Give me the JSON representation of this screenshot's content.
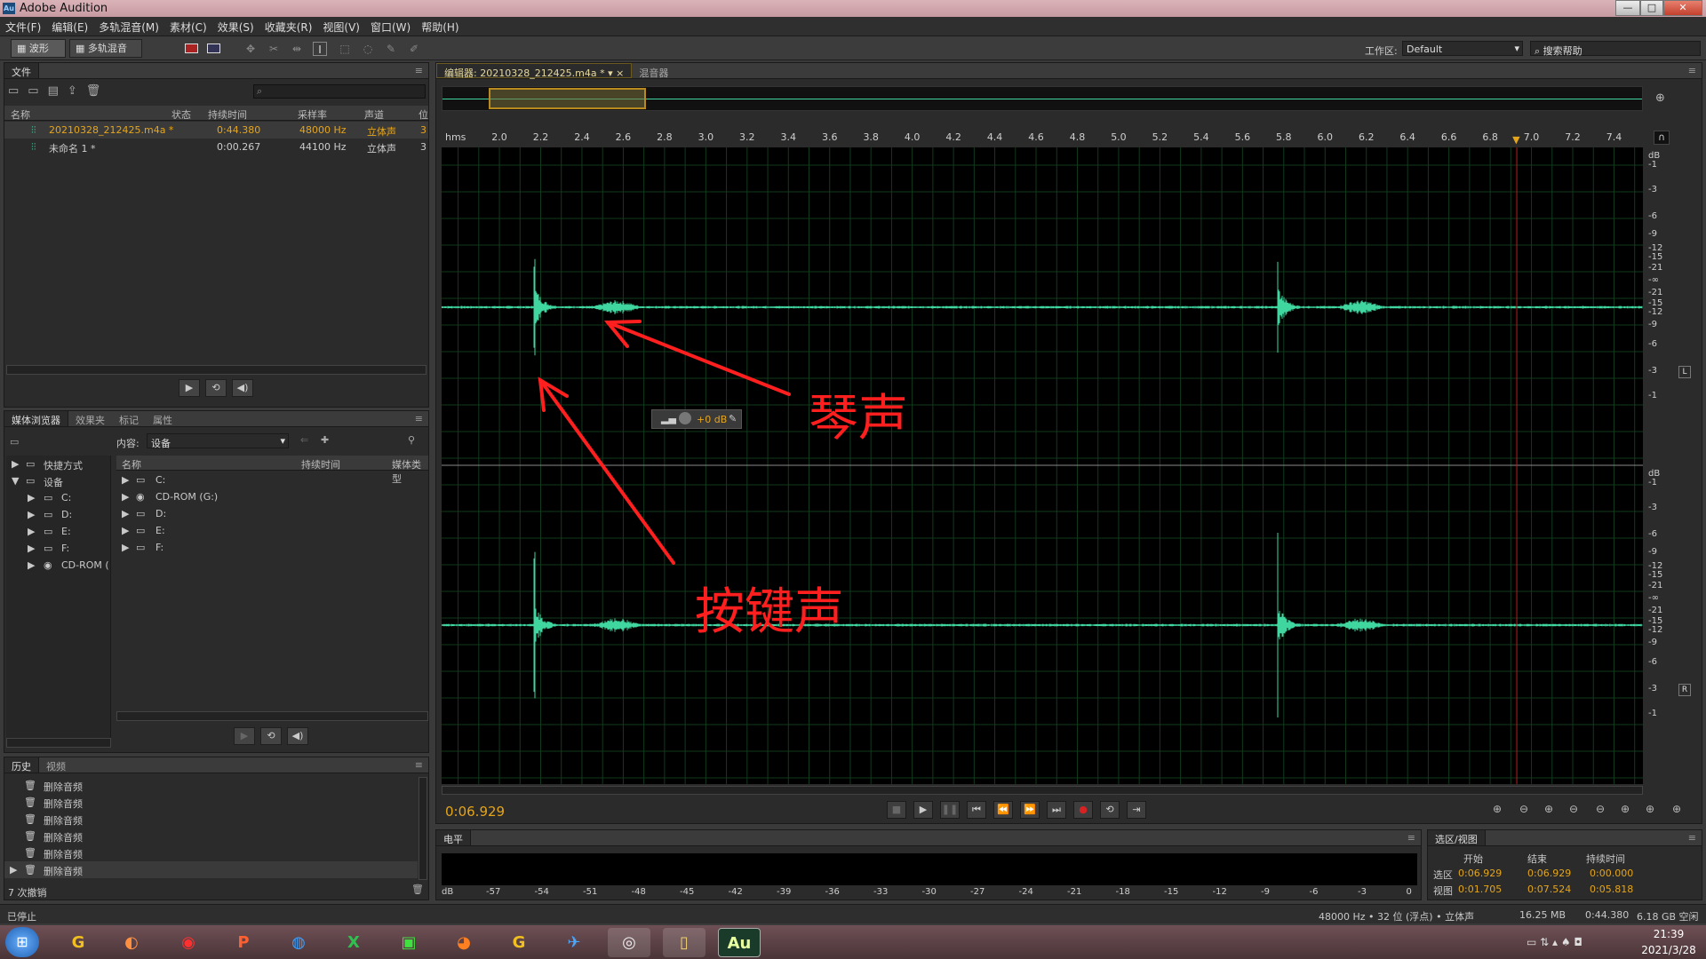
{
  "app": {
    "title": "Adobe Audition",
    "logo": "Au"
  },
  "window_buttons": [
    "—",
    "□",
    "✕"
  ],
  "menu": [
    "文件(F)",
    "编辑(E)",
    "多轨混音(M)",
    "素材(C)",
    "效果(S)",
    "收藏夹(R)",
    "视图(V)",
    "窗口(W)",
    "帮助(H)"
  ],
  "toolbar": {
    "waveform": "波形",
    "multitrack": "多轨混音",
    "workspace_label": "工作区:",
    "workspace_value": "Default",
    "search_placeholder": "搜索帮助"
  },
  "files_panel": {
    "tab": "文件",
    "columns": [
      "名称",
      "状态",
      "持续时间",
      "采样率",
      "声道",
      "位"
    ],
    "rows": [
      {
        "name": "20210328_212425.m4a *",
        "duration": "0:44.380",
        "rate": "48000 Hz",
        "channels": "立体声",
        "bits": "3"
      },
      {
        "name": "未命名 1 *",
        "duration": "0:00.267",
        "rate": "44100 Hz",
        "channels": "立体声",
        "bits": "3"
      }
    ]
  },
  "media_panel": {
    "tabs": [
      "媒体浏览器",
      "效果夹",
      "标记",
      "属性"
    ],
    "content_label": "内容:",
    "content_value": "设备",
    "tree": [
      {
        "label": "快捷方式"
      },
      {
        "label": "设备"
      },
      {
        "label": "C:"
      },
      {
        "label": "D:"
      },
      {
        "label": "E:"
      },
      {
        "label": "F:"
      },
      {
        "label": "CD-ROM ("
      }
    ],
    "columns": [
      "名称",
      "持续时间",
      "媒体类型"
    ],
    "items": [
      "C:",
      "CD-ROM (G:)",
      "D:",
      "E:",
      "F:"
    ]
  },
  "history_panel": {
    "tabs": [
      "历史",
      "视频"
    ],
    "items": [
      "删除音频",
      "删除音频",
      "删除音频",
      "删除音频",
      "删除音频",
      "删除音频"
    ],
    "undo_count": "7 次撤销"
  },
  "editor": {
    "tabs": [
      "编辑器: 20210328_212425.m4a *",
      "混音器"
    ],
    "ruler_unit": "hms",
    "ticks": [
      "2.0",
      "2.2",
      "2.4",
      "2.6",
      "2.8",
      "3.0",
      "3.2",
      "3.4",
      "3.6",
      "3.8",
      "4.0",
      "4.2",
      "4.4",
      "4.6",
      "4.8",
      "5.0",
      "5.2",
      "5.4",
      "5.6",
      "5.8",
      "6.0",
      "6.2",
      "6.4",
      "6.6",
      "6.8",
      "7.0",
      "7.2",
      "7.4"
    ],
    "db_labels_top": [
      "dB",
      "-1",
      "-3",
      "-6",
      "-9",
      "-12",
      "-15",
      "-21",
      "-∞",
      "-21",
      "-15",
      "-12",
      "-9",
      "-6",
      "-3",
      "-1"
    ],
    "db_labels_bottom": [
      "dB",
      "-1",
      "-3",
      "-6",
      "-9",
      "-12",
      "-15",
      "-21",
      "-∞",
      "-21",
      "-15",
      "-12",
      "-9",
      "-6",
      "-3",
      "-1"
    ],
    "channel_left": "L",
    "channel_right": "R",
    "hud": "+0 dB",
    "current_time": "0:06.929",
    "playhead_seconds": 6.929,
    "view_start": 1.705,
    "view_end": 7.524,
    "transient_times": [
      2.17,
      5.77
    ]
  },
  "annotations": {
    "piano": "琴声",
    "keys": "按键声"
  },
  "level_panel": {
    "tab": "电平",
    "scale": [
      "dB",
      "-57",
      "-54",
      "-51",
      "-48",
      "-45",
      "-42",
      "-39",
      "-36",
      "-33",
      "-30",
      "-27",
      "-24",
      "-21",
      "-18",
      "-15",
      "-12",
      "-9",
      "-6",
      "-3",
      "0"
    ]
  },
  "selection_panel": {
    "tab": "选区/视图",
    "headers": [
      "开始",
      "结束",
      "持续时间"
    ],
    "selection": {
      "label": "选区",
      "start": "0:06.929",
      "end": "0:06.929",
      "duration": "0:00.000"
    },
    "view": {
      "label": "视图",
      "start": "0:01.705",
      "end": "0:07.524",
      "duration": "0:05.818"
    }
  },
  "statusbar": {
    "left": "已停止",
    "format": "48000 Hz • 32 位 (浮点) • 立体声",
    "size": "16.25 MB",
    "duration": "0:44.380",
    "free": "6.18 GB 空闲"
  },
  "taskbar": {
    "time": "21:39",
    "date": "2021/3/28"
  },
  "colors": {
    "waveform": "#3fd6a0",
    "accent": "#e5a51a",
    "playhead": "#c01818",
    "annotation": "#ff1f1f"
  }
}
